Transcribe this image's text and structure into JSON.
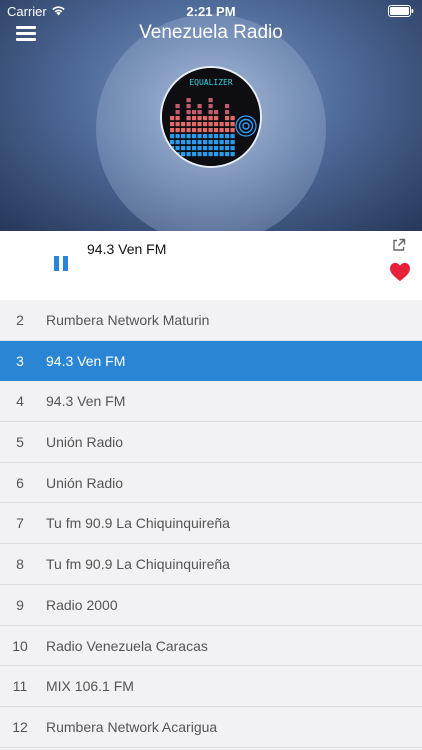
{
  "status_bar": {
    "carrier": "Carrier",
    "time": "2:21 PM"
  },
  "header": {
    "title": "Venezuela Radio",
    "artwork_text": "EQUALIZER"
  },
  "now_playing": {
    "title": "94.3 Ven FM",
    "state": "playing"
  },
  "stations": [
    {
      "num": "2",
      "name": "Rumbera Network Maturin",
      "active": false
    },
    {
      "num": "3",
      "name": "94.3 Ven FM",
      "active": true
    },
    {
      "num": "4",
      "name": "94.3 Ven FM",
      "active": false
    },
    {
      "num": "5",
      "name": "Unión Radio",
      "active": false
    },
    {
      "num": "6",
      "name": "Unión Radio",
      "active": false
    },
    {
      "num": "7",
      "name": "Tu fm 90.9 La Chiquinquireña",
      "active": false
    },
    {
      "num": "8",
      "name": "Tu fm 90.9 La Chiquinquireña",
      "active": false
    },
    {
      "num": "9",
      "name": "Radio 2000",
      "active": false
    },
    {
      "num": "10",
      "name": "Radio Venezuela Caracas",
      "active": false
    },
    {
      "num": "11",
      "name": "MIX 106.1 FM",
      "active": false
    },
    {
      "num": "12",
      "name": "Rumbera Network Acarigua",
      "active": false
    }
  ],
  "colors": {
    "accent": "#2a86d4",
    "favorite": "#e8203a",
    "list_bg": "#f2f2f4"
  },
  "icons": [
    "wifi-icon",
    "battery-icon",
    "menu-icon",
    "pause-icon",
    "share-icon",
    "heart-icon"
  ]
}
